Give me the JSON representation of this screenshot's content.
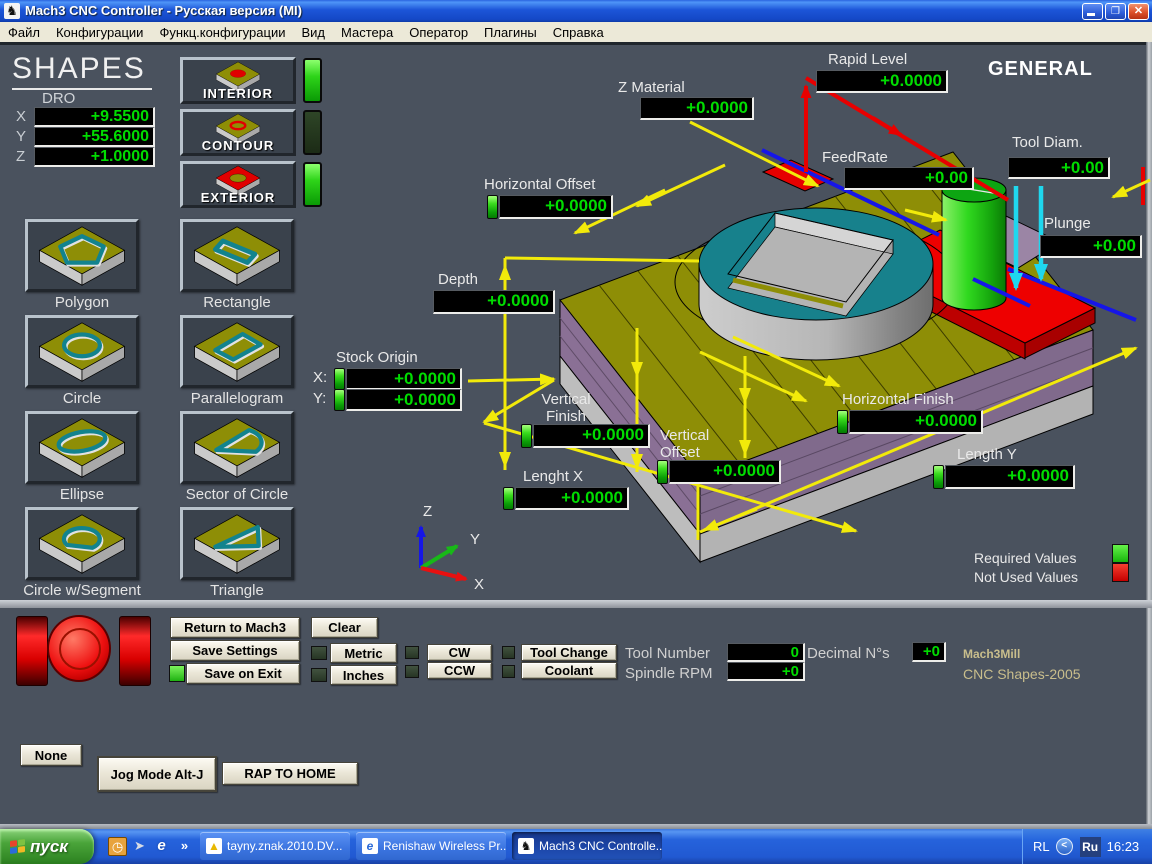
{
  "window": {
    "title": "Mach3 CNC Controller - Русская версия (MI)",
    "controls": {
      "minimize": "",
      "restore": "❐",
      "close": "✕"
    },
    "menu": [
      "Файл",
      "Конфигурации",
      "Функц.конфигурации",
      "Вид",
      "Мастера",
      "Оператор",
      "Плагины",
      "Справка"
    ]
  },
  "header": {
    "title": "SHAPES",
    "dro_caption": "DRO",
    "screen_name": "GENERAL"
  },
  "dro_xyz": {
    "x_label": "X",
    "x_value": "+9.5500",
    "y_label": "Y",
    "y_value": "+55.6000",
    "z_label": "Z",
    "z_value": "+1.0000"
  },
  "mode_buttons": {
    "interior": {
      "label": "INTERIOR",
      "led": "on"
    },
    "contour": {
      "label": "CONTOUR",
      "led": "off"
    },
    "exterior": {
      "label": "EXTERIOR",
      "led": "on"
    }
  },
  "shape_buttons": [
    "Polygon",
    "Rectangle",
    "Circle",
    "Parallelogram",
    "Ellipse",
    "Sector of Circle",
    "Circle w/Segment",
    "Triangle"
  ],
  "params": {
    "z_material": {
      "label": "Z Material",
      "value": "+0.0000"
    },
    "rapid_level": {
      "label": "Rapid Level",
      "value": "+0.0000"
    },
    "feedrate": {
      "label": "FeedRate",
      "value": "+0.00"
    },
    "tool_diam": {
      "label": "Tool Diam.",
      "value": "+0.00"
    },
    "plunge": {
      "label": "Plunge",
      "value": "+0.00"
    },
    "horizontal_offset": {
      "label": "Horizontal Offset",
      "value": "+0.0000"
    },
    "depth": {
      "label": "Depth",
      "value": "+0.0000"
    },
    "stock_origin": {
      "label": "Stock Origin",
      "x_label": "X:",
      "x_value": "+0.0000",
      "y_label": "Y:",
      "y_value": "+0.0000"
    },
    "vertical_finish": {
      "label": "Vertical Finish",
      "value": "+0.0000"
    },
    "vertical_offset": {
      "label": "Vertical Offset",
      "value": "+0.0000"
    },
    "lenght_x": {
      "label": "Lenght X",
      "value": "+0.0000"
    },
    "horizontal_finish": {
      "label": "Horizontal Finish",
      "value": "+0.0000"
    },
    "length_y": {
      "label": "Length Y",
      "value": "+0.0000"
    }
  },
  "axis": {
    "x": "X",
    "y": "Y",
    "z": "Z"
  },
  "legend": {
    "required": "Required Values",
    "not_used": "Not Used Values",
    "required_color": "#22DD22",
    "not_used_color": "#E80000"
  },
  "controls": {
    "return_to_mach3": "Return to Mach3",
    "save_settings": "Save Settings",
    "save_on_exit": "Save on Exit",
    "clear": "Clear",
    "metric": "Metric",
    "inches": "Inches",
    "cw": "CW",
    "ccw": "CCW",
    "tool_change": "Tool Change",
    "coolant": "Coolant",
    "tool_number_label": "Tool Number",
    "tool_number_value": "0",
    "spindle_rpm_label": "Spindle RPM",
    "spindle_rpm_value": "+0",
    "decimal_label": "Decimal N°s",
    "decimal_value": "+0",
    "brand_line1": "Mach3Mill",
    "brand_line2": "CNC Shapes-2005",
    "none": "None",
    "jog_mode": "Jog Mode Alt-J",
    "rap_to_home": "RAP TO HOME"
  },
  "taskbar": {
    "start_label": "пуск",
    "overflow_chevron": "»",
    "icons": {
      "ie": "e",
      "mach3": "♞",
      "triangle": "▲",
      "pointer": "➤"
    },
    "tasks": [
      {
        "icon": "triangle-app-icon",
        "label": "tayny.znak.2010.DV..."
      },
      {
        "icon": "ie-icon",
        "label": "Renishaw Wireless Pr..."
      },
      {
        "icon": "mach3-icon",
        "label": "Mach3 CNC Controlle...",
        "active": true
      }
    ],
    "tray": {
      "rl": "RL",
      "chevron": "<",
      "lang": "Ru",
      "time": "16:23"
    }
  },
  "colors": {
    "dro_text": "#00DC00",
    "led_on": "#2ED419",
    "led_off": "#24391D",
    "screen_bg": "#4A525E",
    "accent_yellow": "#F2EA0A",
    "accent_red": "#E80000",
    "accent_blue": "#1616E8",
    "accent_cyan": "#1FD7EE"
  }
}
